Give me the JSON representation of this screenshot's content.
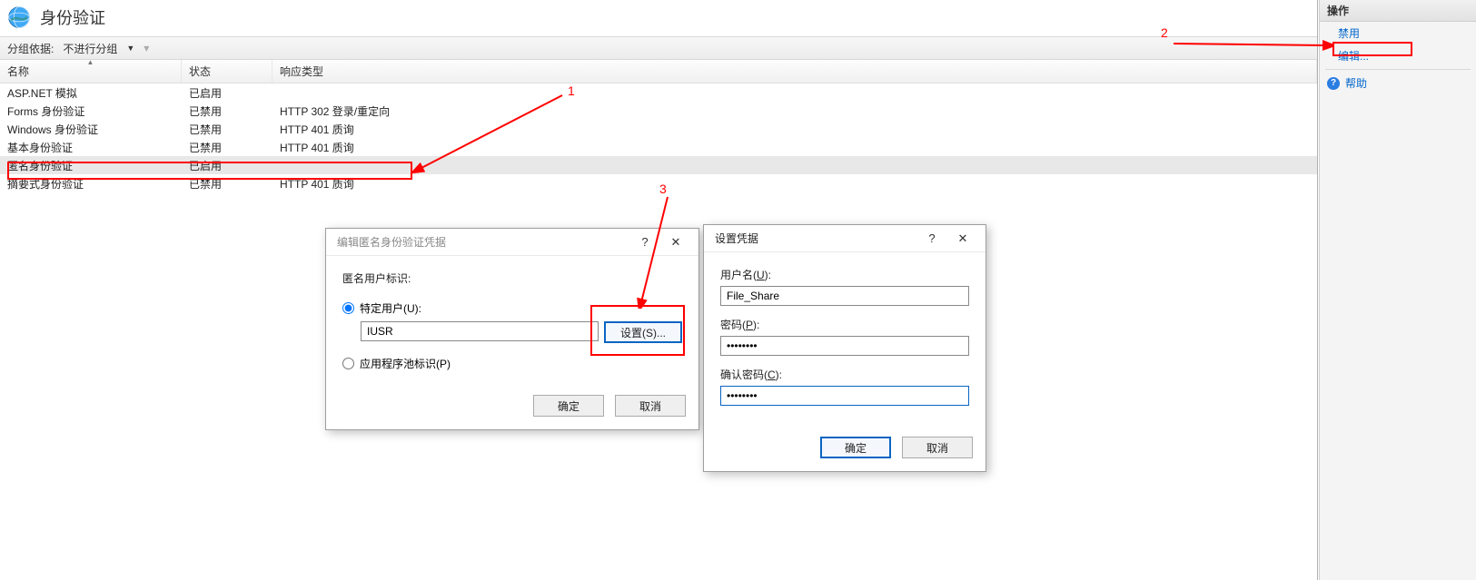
{
  "header": {
    "title": "身份验证"
  },
  "groupbar": {
    "label": "分组依据:",
    "value": "不进行分组"
  },
  "columns": {
    "name": "名称",
    "status": "状态",
    "response": "响应类型"
  },
  "rows": [
    {
      "name": "ASP.NET 模拟",
      "status": "已启用",
      "response": ""
    },
    {
      "name": "Forms 身份验证",
      "status": "已禁用",
      "response": "HTTP 302 登录/重定向"
    },
    {
      "name": "Windows 身份验证",
      "status": "已禁用",
      "response": "HTTP 401 质询"
    },
    {
      "name": "基本身份验证",
      "status": "已禁用",
      "response": "HTTP 401 质询"
    },
    {
      "name": "匿名身份验证",
      "status": "已启用",
      "response": ""
    },
    {
      "name": "摘要式身份验证",
      "status": "已禁用",
      "response": "HTTP 401 质询"
    }
  ],
  "actions": {
    "title": "操作",
    "disable": "禁用",
    "edit": "编辑...",
    "help": "帮助"
  },
  "dialog_anon": {
    "title": "编辑匿名身份验证凭据",
    "identity_label": "匿名用户标识:",
    "opt_specific": "特定用户(U):",
    "opt_pool": "应用程序池标识(P)",
    "user_value": "IUSR",
    "set_btn": "设置(S)...",
    "ok": "确定",
    "cancel": "取消"
  },
  "dialog_cred": {
    "title": "设置凭据",
    "user_label_pre": "用户名(",
    "user_label_u": "U",
    "user_label_post": "):",
    "user_value": "File_Share",
    "pass_label_pre": "密码(",
    "pass_label_u": "P",
    "pass_label_post": "):",
    "pass_value": "••••••••",
    "confirm_label_pre": "确认密码(",
    "confirm_label_u": "C",
    "confirm_label_post": "):",
    "confirm_value": "••••••••",
    "ok": "确定",
    "cancel": "取消"
  },
  "anno": {
    "n1": "1",
    "n2": "2",
    "n3": "3"
  }
}
